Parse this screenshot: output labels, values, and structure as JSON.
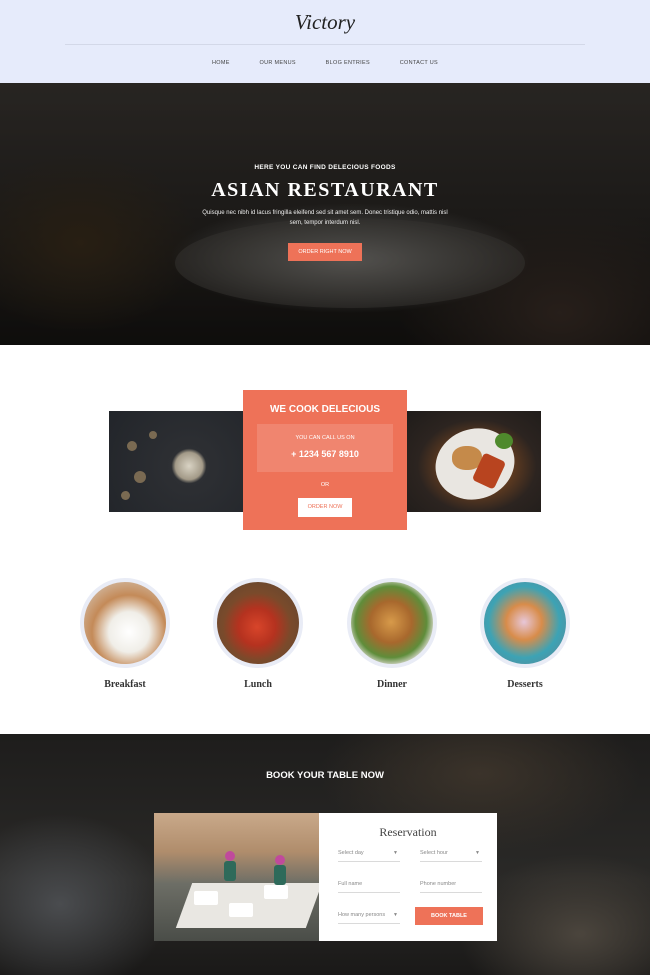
{
  "header": {
    "logo": "Victory",
    "nav": [
      "HOME",
      "OUR MENUS",
      "BLOG ENTRIES",
      "CONTACT US"
    ]
  },
  "hero": {
    "subtitle": "HERE YOU CAN FIND DELECIOUS FOODS",
    "title": "ASIAN RESTAURANT",
    "text": "Quisque nec nibh id lacus fringilla eleifend sed sit amet sem. Donec tristique odio, mattis nisl sem, tempor interdum nisl.",
    "button": "ORDER RIGHT NOW"
  },
  "cook": {
    "title": "WE COOK DELECIOUS",
    "call_label": "YOU CAN CALL US ON",
    "phone": "+ 1234 567 8910",
    "or": "OR",
    "button": "ORDER NOW"
  },
  "menus": [
    {
      "label": "Breakfast",
      "icon": "breakfast-photo"
    },
    {
      "label": "Lunch",
      "icon": "lunch-photo"
    },
    {
      "label": "Dinner",
      "icon": "dinner-photo"
    },
    {
      "label": "Desserts",
      "icon": "desserts-photo"
    }
  ],
  "booking": {
    "title": "BOOK YOUR TABLE NOW",
    "reservation_title": "Reservation",
    "select_day": "Select day",
    "select_hour": "Select hour",
    "full_name": "Full name",
    "phone_number": "Phone number",
    "persons": "How many persons",
    "button": "BOOK TABLE"
  },
  "colors": {
    "accent": "#ee7258",
    "header_bg": "#e6ebfb",
    "dark_bg": "#1e1d1c"
  }
}
